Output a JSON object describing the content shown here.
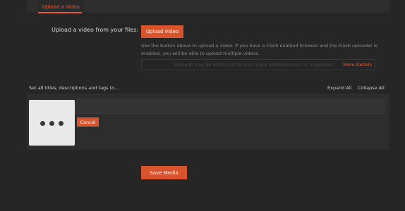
{
  "tabs": [
    {
      "label": "Upload a Video",
      "active": true
    }
  ],
  "upload": {
    "label": "Upload a video from your files:",
    "button_label": "Upload Video",
    "help_text": "Use the button above to upload a video. If you have a Flash enabled browser and the Flash uploader is enabled, you will be able to upload multiple videos.",
    "notice_text": "Uploads may be restricted by your site's administrators or inspected",
    "more_details_label": "More Details"
  },
  "bulk": {
    "label": "Set all titles, descriptions and tags to...",
    "expand_all_label": "Expand All",
    "collapse_all_label": "Collapse All"
  },
  "media_item": {
    "thumbnail_icon": "ellipsis-icon",
    "cancel_label": "Cancel"
  },
  "footer": {
    "save_label": "Save Media"
  },
  "colors": {
    "accent": "#d9532c",
    "link": "#e8603a",
    "background": "#262626",
    "panel": "#2d2d2d"
  }
}
